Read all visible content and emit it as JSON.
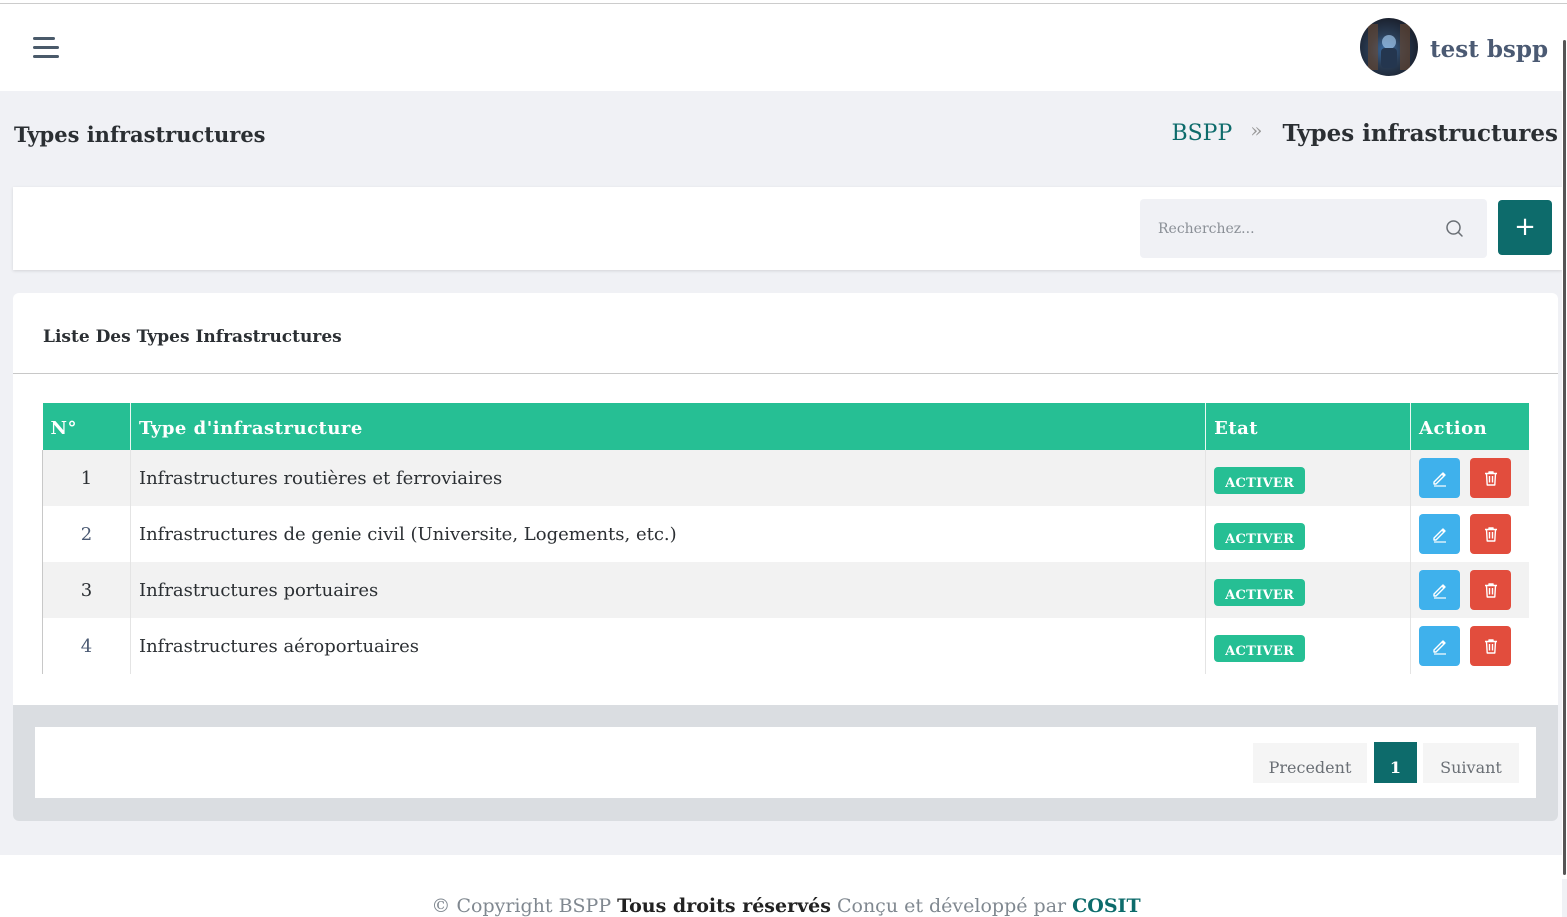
{
  "header": {
    "username": "test bspp",
    "menu_icon": "hamburger-menu-icon",
    "avatar_icon": "user-avatar"
  },
  "page": {
    "title": "Types infrastructures"
  },
  "breadcrumb": {
    "root": "BSPP",
    "separator": "»",
    "current": "Types infrastructures"
  },
  "search": {
    "placeholder": "Recherchez...",
    "icon": "search-icon",
    "add_label": "+"
  },
  "list": {
    "title": "Liste Des Types Infrastructures",
    "columns": [
      "N°",
      "Type d'infrastructure",
      "Etat",
      "Action"
    ],
    "rows": [
      {
        "num": "1",
        "type": "Infrastructures routières et ferroviaires",
        "etat": "ACTIVER"
      },
      {
        "num": "2",
        "type": "Infrastructures de genie civil (Universite, Logements, etc.)",
        "etat": "ACTIVER"
      },
      {
        "num": "3",
        "type": "Infrastructures portuaires",
        "etat": "ACTIVER"
      },
      {
        "num": "4",
        "type": "Infrastructures aéroportuaires",
        "etat": "ACTIVER"
      }
    ]
  },
  "pagination": {
    "prev": "Precedent",
    "current": "1",
    "next": "Suivant"
  },
  "footer": {
    "copyright": "© Copyright BSPP",
    "rights": "Tous droits réservés",
    "designed": "Conçu et développé par",
    "company": "COSIT"
  },
  "colors": {
    "primary": "#0d6b6b",
    "table_header": "#26bf94",
    "badge": "#26bf94",
    "edit": "#3fb1ec",
    "delete": "#e24d3d"
  }
}
